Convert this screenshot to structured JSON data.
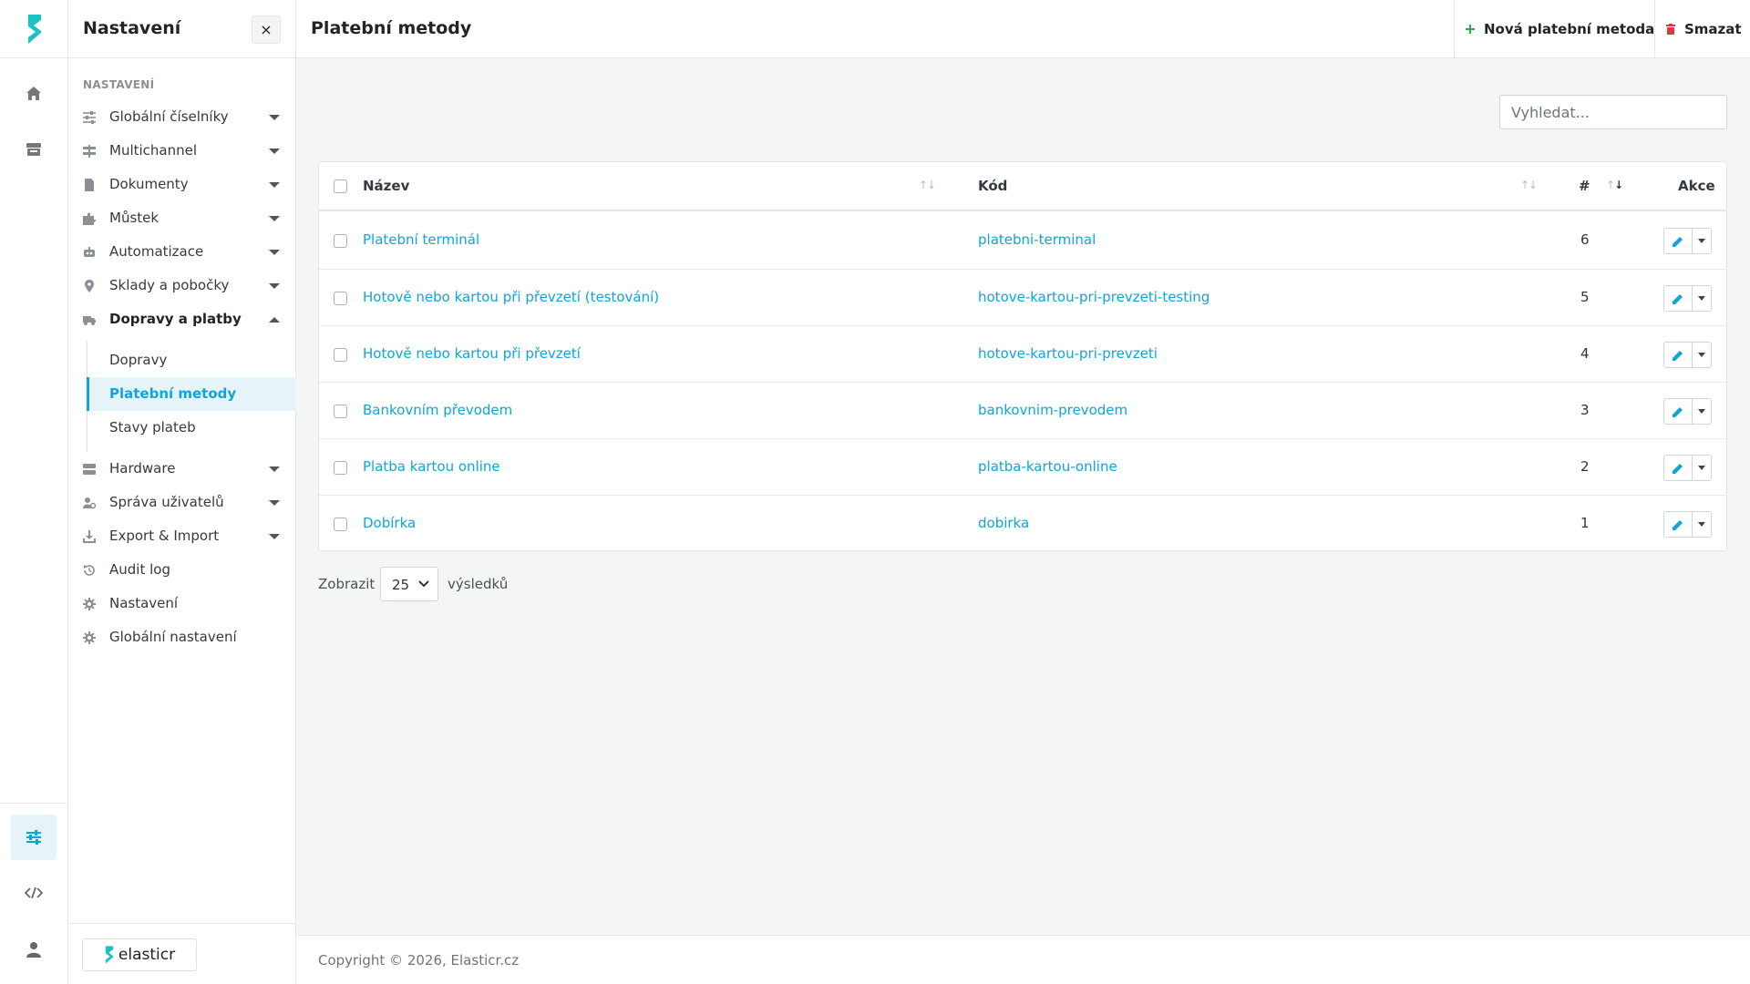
{
  "sidebar": {
    "title": "Nastavení",
    "close_symbol": "×",
    "section_label": "NASTAVENÍ",
    "items": [
      {
        "label": "Globální číselníky",
        "icon": "sliders-icon"
      },
      {
        "label": "Multichannel",
        "icon": "signpost-icon"
      },
      {
        "label": "Dokumenty",
        "icon": "file-icon"
      },
      {
        "label": "Můstek",
        "icon": "puzzle-icon"
      },
      {
        "label": "Automatizace",
        "icon": "robot-icon"
      },
      {
        "label": "Sklady a pobočky",
        "icon": "map-pin-icon"
      },
      {
        "label": "Dopravy a platby",
        "icon": "truck-icon"
      },
      {
        "label": "Hardware",
        "icon": "server-icon"
      },
      {
        "label": "Správa uživatelů",
        "icon": "users-cog-icon"
      },
      {
        "label": "Export & Import",
        "icon": "download-icon"
      },
      {
        "label": "Audit log",
        "icon": "history-icon"
      },
      {
        "label": "Nastavení",
        "icon": "gear-icon"
      },
      {
        "label": "Globální nastavení",
        "icon": "gear-icon"
      }
    ],
    "subitems": [
      {
        "label": "Dopravy"
      },
      {
        "label": "Platební metody"
      },
      {
        "label": "Stavy plateb"
      }
    ],
    "brand": "elasticr"
  },
  "header": {
    "title": "Platební metody",
    "new_label": "Nová platební metoda",
    "delete_label": "Smazat"
  },
  "search": {
    "placeholder": "Vyhledat..."
  },
  "table": {
    "columns": {
      "name": "Název",
      "code": "Kód",
      "id": "#",
      "actions": "Akce"
    },
    "rows": [
      {
        "name": "Platební terminál",
        "code": "platebni-terminal",
        "id": "6"
      },
      {
        "name": "Hotově nebo kartou při převzetí (testování)",
        "code": "hotove-kartou-pri-prevzeti-testing",
        "id": "5"
      },
      {
        "name": "Hotově nebo kartou při převzetí",
        "code": "hotove-kartou-pri-prevzeti",
        "id": "4"
      },
      {
        "name": "Bankovním převodem",
        "code": "bankovnim-prevodem",
        "id": "3"
      },
      {
        "name": "Platba kartou online",
        "code": "platba-kartou-online",
        "id": "2"
      },
      {
        "name": "Dobírka",
        "code": "dobirka",
        "id": "1"
      }
    ]
  },
  "pagination": {
    "show_label": "Zobrazit",
    "page_size": "25",
    "results_label": "výsledků"
  },
  "footer": {
    "copyright": "Copyright © 2026, Elasticr.cz"
  },
  "colors": {
    "accent": "#0ea5d8",
    "add": "#28a745",
    "danger": "#dc3545"
  }
}
